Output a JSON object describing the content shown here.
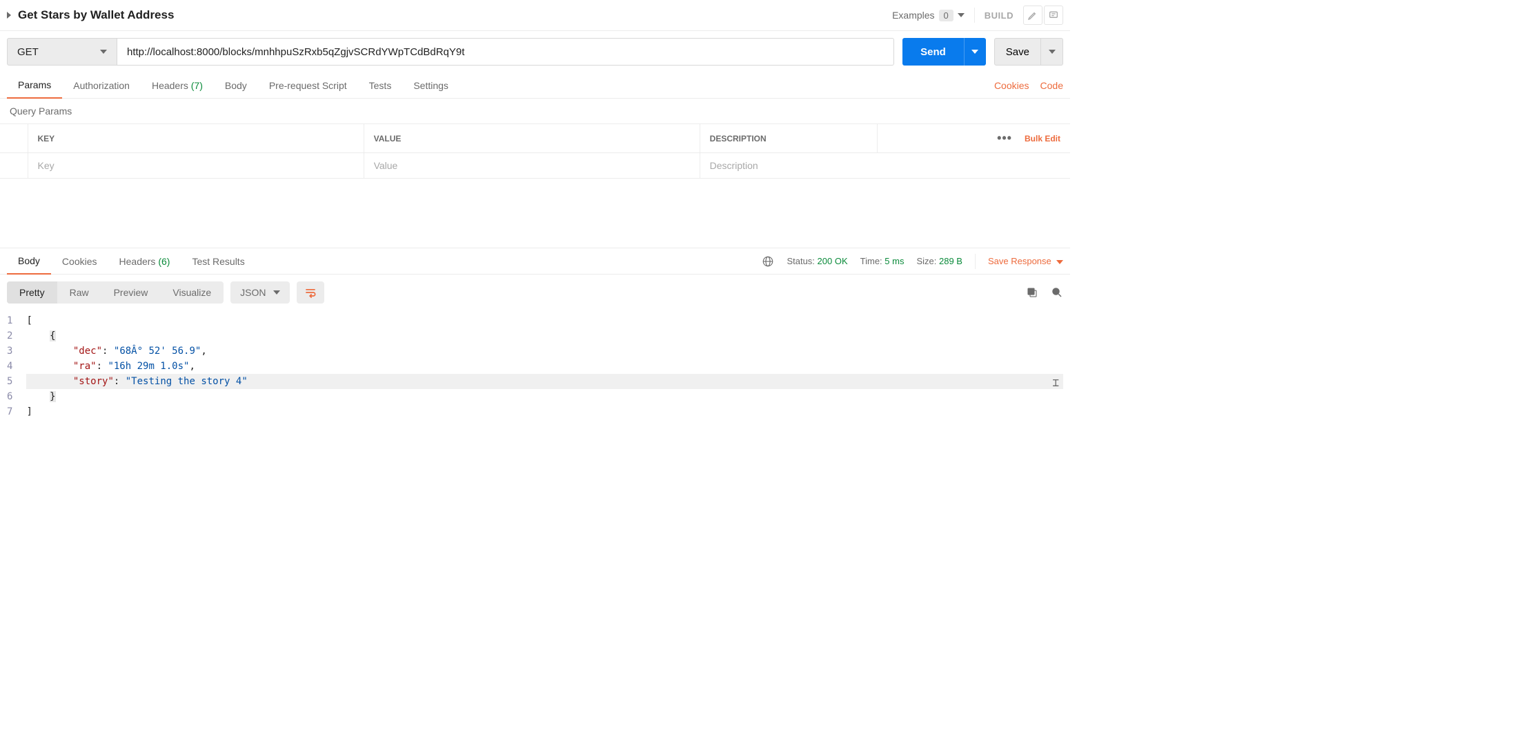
{
  "header": {
    "title": "Get Stars by Wallet Address",
    "examples_label": "Examples",
    "examples_count": "0",
    "build_label": "BUILD"
  },
  "request": {
    "method": "GET",
    "url": "http://localhost:8000/blocks/mnhhpuSzRxb5qZgjvSCRdYWpTCdBdRqY9t",
    "send_label": "Send",
    "save_label": "Save"
  },
  "req_tabs": {
    "params": "Params",
    "authorization": "Authorization",
    "headers": "Headers",
    "headers_count": "(7)",
    "body": "Body",
    "prerequest": "Pre-request Script",
    "tests": "Tests",
    "settings": "Settings",
    "cookies": "Cookies",
    "code": "Code"
  },
  "params_section": {
    "title": "Query Params",
    "col_key": "KEY",
    "col_value": "VALUE",
    "col_desc": "DESCRIPTION",
    "bulk_edit": "Bulk Edit",
    "ph_key": "Key",
    "ph_value": "Value",
    "ph_desc": "Description"
  },
  "resp_tabs": {
    "body": "Body",
    "cookies": "Cookies",
    "headers": "Headers",
    "headers_count": "(6)",
    "test_results": "Test Results"
  },
  "resp_meta": {
    "status_label": "Status:",
    "status_value": "200 OK",
    "time_label": "Time:",
    "time_value": "5 ms",
    "size_label": "Size:",
    "size_value": "289 B",
    "save_response": "Save Response"
  },
  "view": {
    "pretty": "Pretty",
    "raw": "Raw",
    "preview": "Preview",
    "visualize": "Visualize",
    "format": "JSON"
  },
  "response_body": {
    "lines": [
      "1",
      "2",
      "3",
      "4",
      "5",
      "6",
      "7"
    ],
    "dec_key": "\"dec\"",
    "dec_val": "\"68Â° 52' 56.9\"",
    "ra_key": "\"ra\"",
    "ra_val": "\"16h 29m 1.0s\"",
    "story_key": "\"story\"",
    "story_val": "\"Testing the story 4\""
  }
}
